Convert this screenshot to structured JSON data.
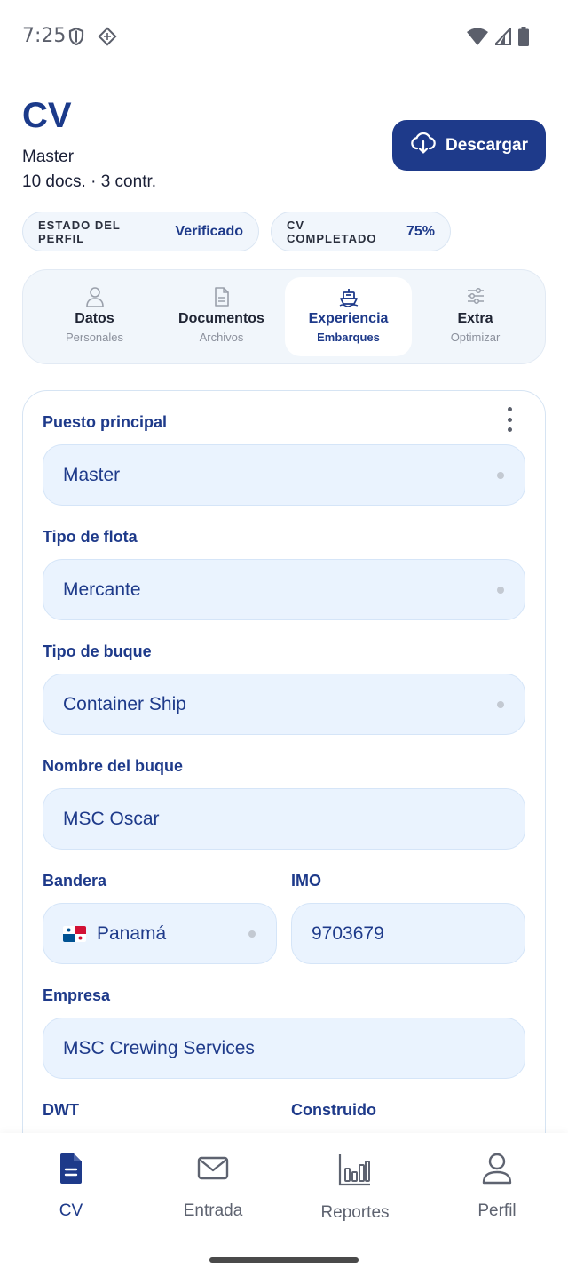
{
  "status_bar": {
    "time": "7:25"
  },
  "header": {
    "title": "CV",
    "role": "Master",
    "stats": "10 docs. · 3 contr.",
    "download_label": "Descargar"
  },
  "chips": {
    "profile_label": "ESTADO DEL PERFIL",
    "profile_value": "Verificado",
    "cv_label": "CV COMPLETADO",
    "cv_value": "75%"
  },
  "tabs": [
    {
      "title": "Datos",
      "subtitle": "Personales",
      "icon": "person-icon"
    },
    {
      "title": "Documentos",
      "subtitle": "Archivos",
      "icon": "document-icon"
    },
    {
      "title": "Experiencia",
      "subtitle": "Embarques",
      "icon": "ship-icon",
      "active": true
    },
    {
      "title": "Extra",
      "subtitle": "Optimizar",
      "icon": "sliders-icon"
    }
  ],
  "form": {
    "puesto": {
      "label": "Puesto principal",
      "value": "Master"
    },
    "flota": {
      "label": "Tipo de flota",
      "value": "Mercante"
    },
    "buque_tipo": {
      "label": "Tipo de buque",
      "value": "Container Ship"
    },
    "buque_nombre": {
      "label": "Nombre del buque",
      "value": "MSC Oscar"
    },
    "bandera": {
      "label": "Bandera",
      "value": "Panamá"
    },
    "imo": {
      "label": "IMO",
      "value": "9703679"
    },
    "empresa": {
      "label": "Empresa",
      "value": "MSC Crewing Services"
    },
    "dwt": {
      "label": "DWT"
    },
    "construido": {
      "label": "Construido"
    }
  },
  "bottom_nav": [
    {
      "label": "CV",
      "icon": "document-icon",
      "active": true
    },
    {
      "label": "Entrada",
      "icon": "mail-icon"
    },
    {
      "label": "Reportes",
      "icon": "bar-chart-icon"
    },
    {
      "label": "Perfil",
      "icon": "person-icon"
    }
  ],
  "colors": {
    "primary": "#1e3a8a",
    "field_bg": "#eaf3fe",
    "chip_bg": "#f1f6fc"
  }
}
